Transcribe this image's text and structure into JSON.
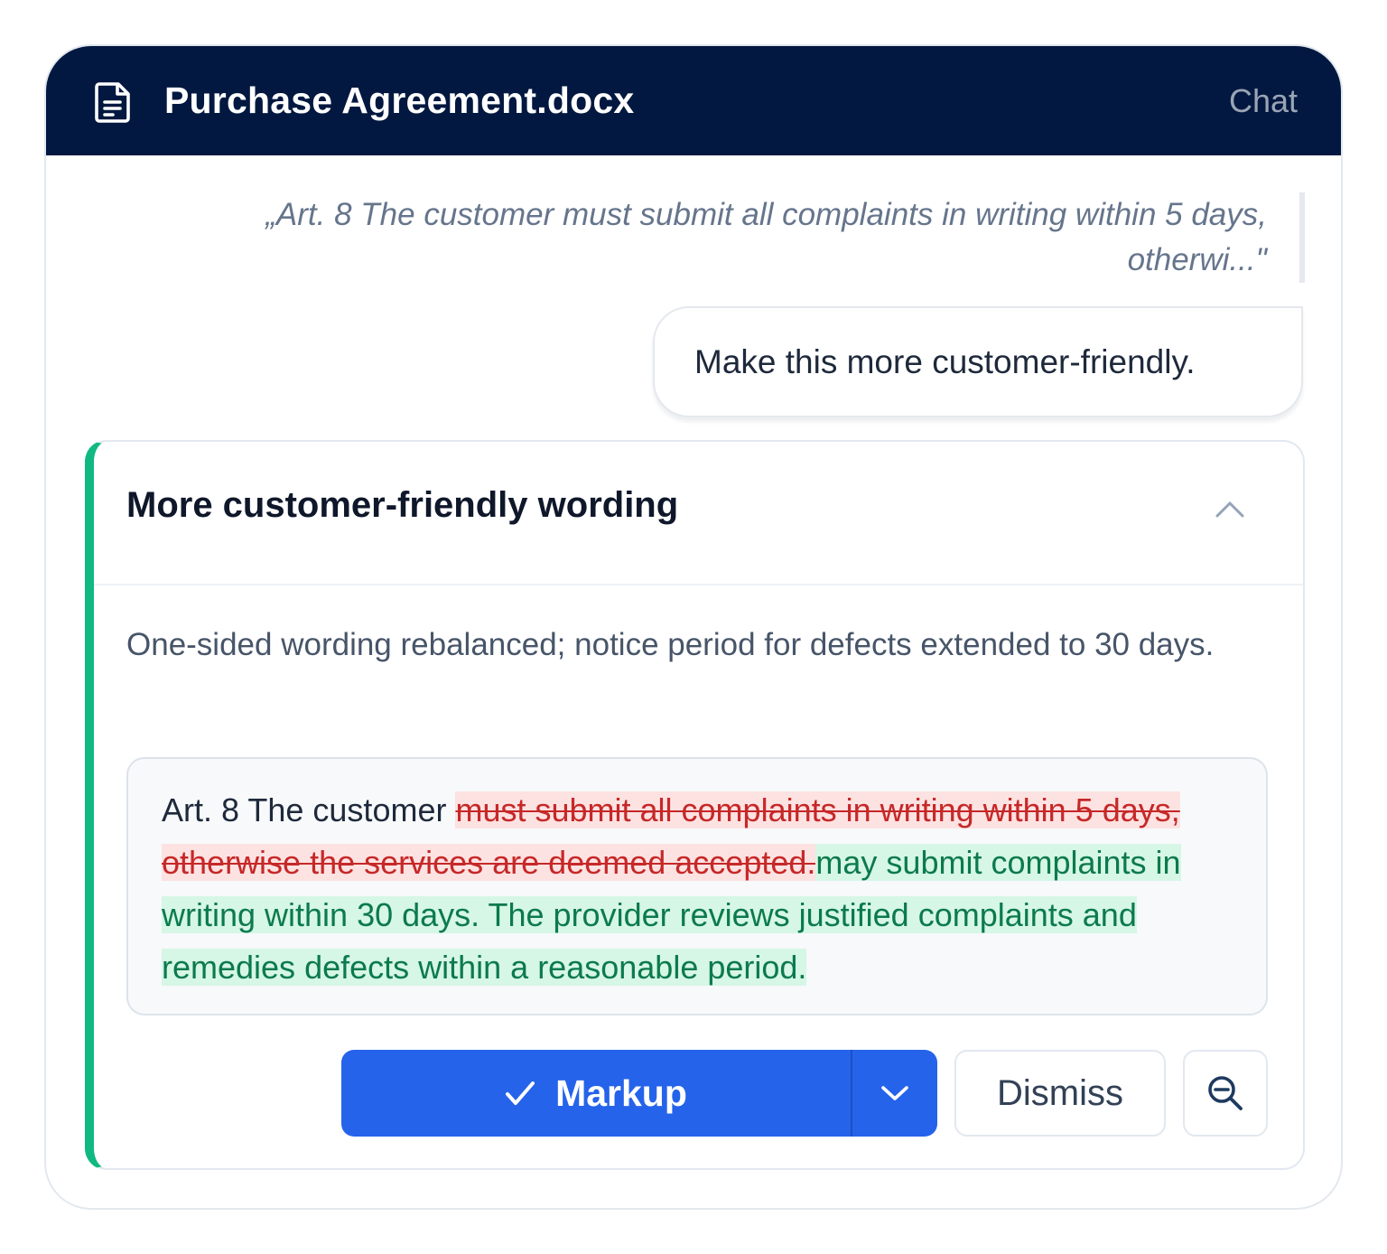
{
  "window": {
    "title": "Purchase Agreement.docx",
    "tab_label": "Chat",
    "header_bg": "#021840"
  },
  "chat": {
    "quoted_text": "„Art. 8 The customer must submit all complaints in writing within 5 days, otherwi...\"",
    "user_message": "Make this more customer-friendly."
  },
  "suggestion": {
    "title": "More customer-friendly wording",
    "summary": "One-sided wording rebalanced; notice period for defects extended to 30 days.",
    "accent_color": "#10b981",
    "diff": {
      "unchanged": "Art. 8 The customer ",
      "deleted": "must submit all complaints in writing within 5 days, otherwise the services are deemed accepted.",
      "inserted": "may submit complaints in writing within 30 days. The provider reviews justified complaints and remedies defects within a reasonable period."
    },
    "actions": {
      "markup_label": "Markup",
      "dismiss_label": "Dismiss",
      "primary_color": "#2563eb"
    },
    "icons": {
      "document": "document-icon",
      "collapse": "chevron-up-icon",
      "check": "check-icon",
      "dropdown": "chevron-down-icon",
      "zoom": "zoom-out-icon"
    }
  }
}
